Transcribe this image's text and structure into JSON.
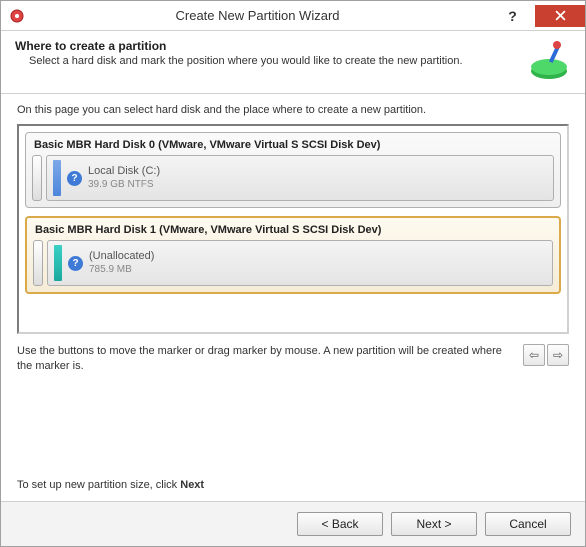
{
  "titlebar": {
    "title": "Create New Partition Wizard"
  },
  "header": {
    "title": "Where to create a partition",
    "subtitle": "Select a hard disk and mark the position where you would like to create the new partition."
  },
  "instruction": "On this page you can select hard disk and the place where to create a new partition.",
  "disks": [
    {
      "label": "Basic MBR Hard Disk 0 (VMware, VMware Virtual S SCSI Disk Dev)",
      "partition": {
        "name": "Local Disk (C:)",
        "size": "39.9 GB NTFS",
        "color": "blue"
      },
      "selected": false
    },
    {
      "label": "Basic MBR Hard Disk 1 (VMware, VMware Virtual S SCSI Disk Dev)",
      "partition": {
        "name": "(Unallocated)",
        "size": "785.9 MB",
        "color": "teal"
      },
      "selected": true
    }
  ],
  "marker_help": "Use the buttons to move the marker or drag marker by mouse. A new partition will be created where the marker is.",
  "next_hint_prefix": "To set up new partition size, click ",
  "next_hint_bold": "Next",
  "buttons": {
    "back": "< Back",
    "next": "Next >",
    "cancel": "Cancel"
  },
  "icons": {
    "info": "?"
  }
}
